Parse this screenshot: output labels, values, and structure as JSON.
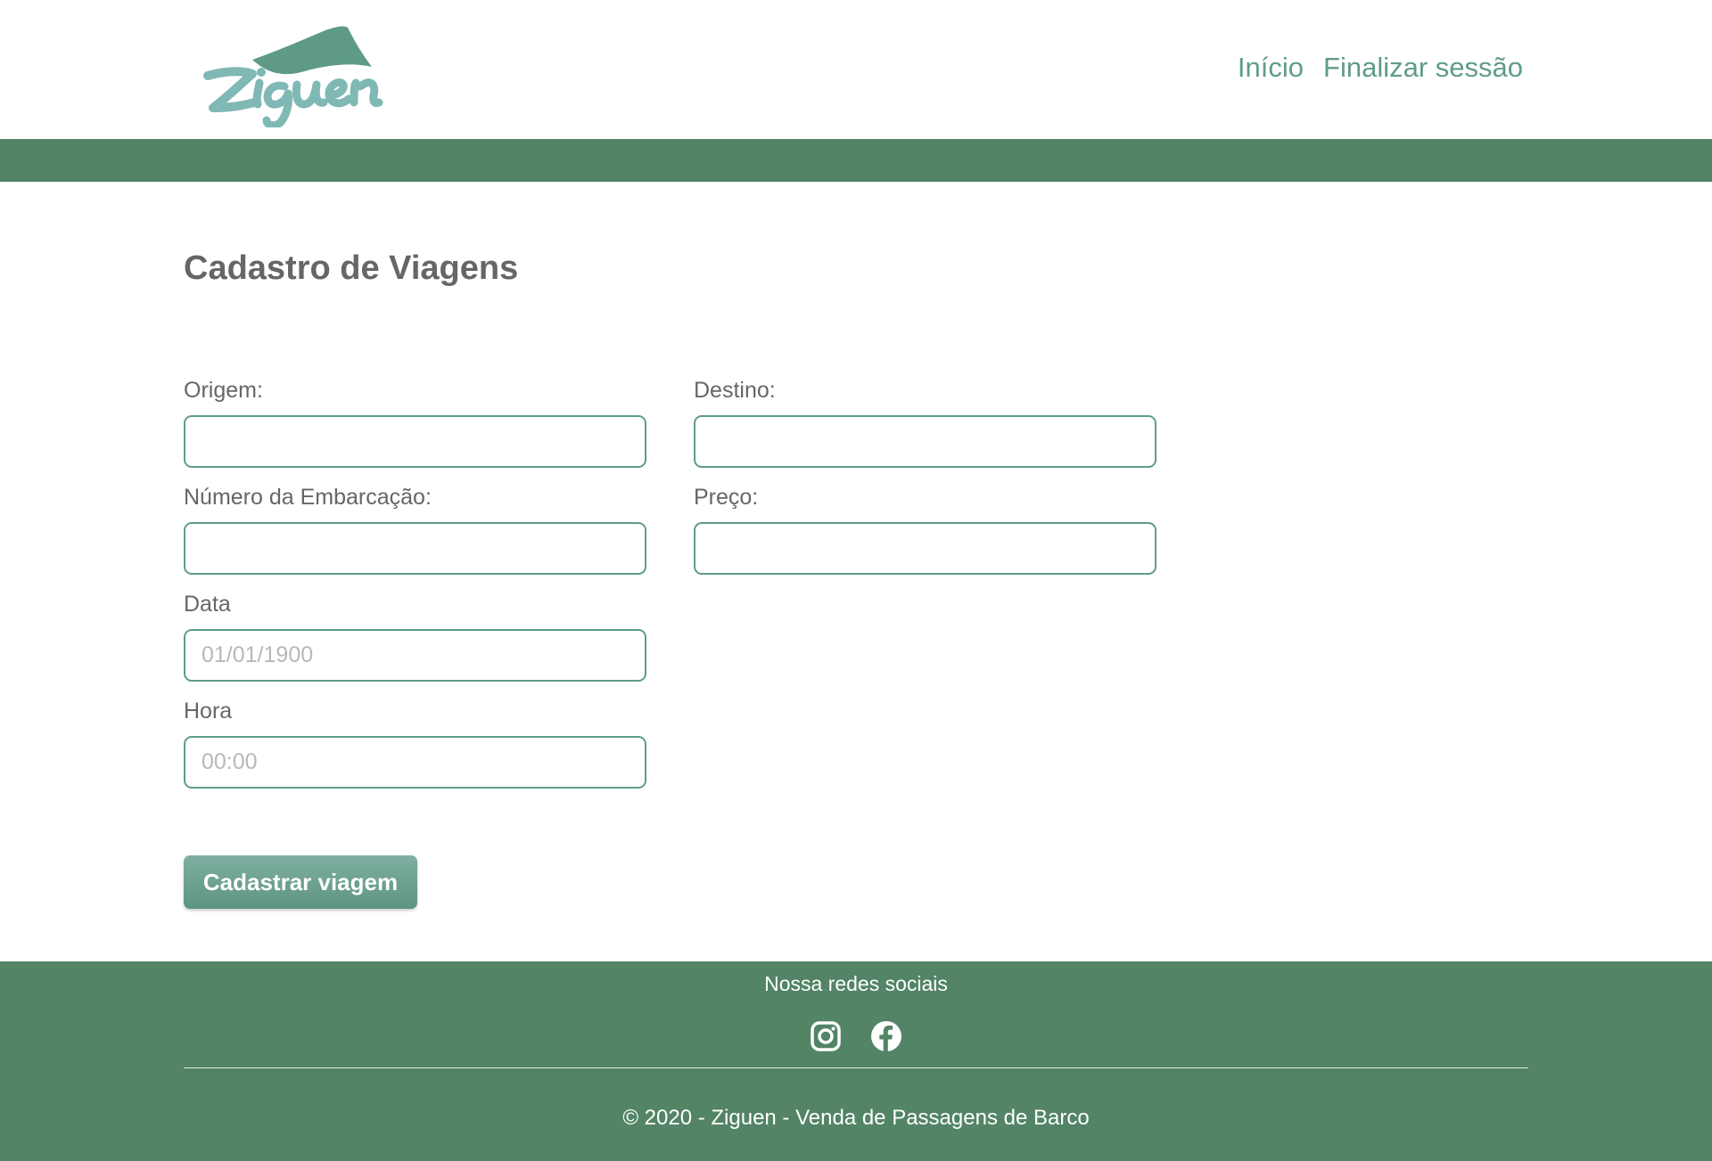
{
  "header": {
    "logo_text": "Ziguen",
    "nav": {
      "home_label": "Início",
      "logout_label": "Finalizar sessão"
    }
  },
  "main": {
    "title": "Cadastro de Viagens",
    "form": {
      "origin": {
        "label": "Origem:",
        "value": "",
        "placeholder": ""
      },
      "destination": {
        "label": "Destino:",
        "value": "",
        "placeholder": ""
      },
      "vessel_number": {
        "label": "Número da Embarcação:",
        "value": "",
        "placeholder": ""
      },
      "price": {
        "label": "Preço:",
        "value": "",
        "placeholder": ""
      },
      "date": {
        "label": "Data",
        "value": "",
        "placeholder": "01/01/1900"
      },
      "time": {
        "label": "Hora",
        "value": "",
        "placeholder": "00:00"
      },
      "submit_label": "Cadastrar viagem"
    }
  },
  "footer": {
    "social_heading": "Nossa redes sociais",
    "social_icons": [
      "instagram-icon",
      "facebook-icon"
    ],
    "copyright": "© 2020 - Ziguen - Venda de Passagens de Barco"
  },
  "colors": {
    "brand_green": "#528465",
    "accent_teal": "#5f9c88",
    "logo_light": "#7fb8b4",
    "logo_dark": "#5e9a86",
    "text_gray": "#666666"
  }
}
